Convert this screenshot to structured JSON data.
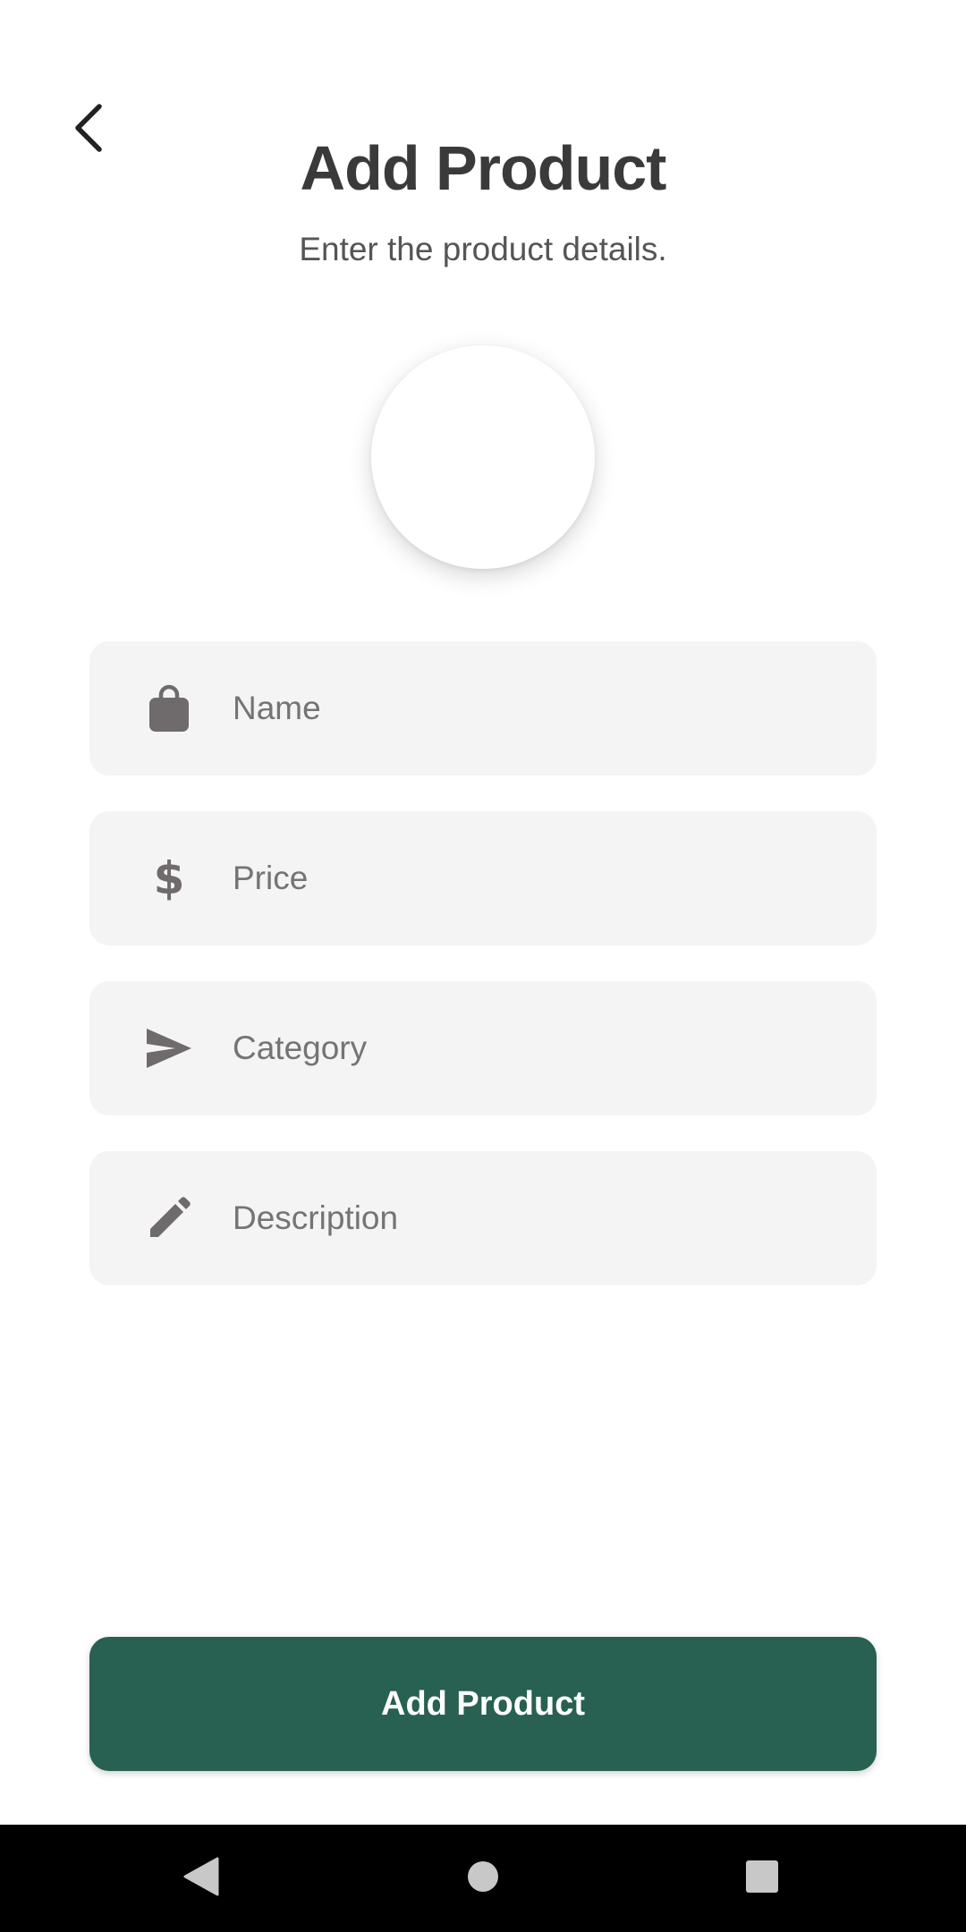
{
  "header": {
    "title": "Add Product",
    "subtitle": "Enter the product details.",
    "back_icon": "chevron-left-icon"
  },
  "image_picker": {
    "icon": "none"
  },
  "form": {
    "fields": [
      {
        "name": "name",
        "placeholder": "Name",
        "value": "",
        "icon": "shopping-bag-icon"
      },
      {
        "name": "price",
        "placeholder": "Price",
        "value": "",
        "icon": "dollar-icon",
        "glyph": "$"
      },
      {
        "name": "category",
        "placeholder": "Category",
        "value": "",
        "icon": "send-icon"
      },
      {
        "name": "description",
        "placeholder": "Description",
        "value": "",
        "icon": "pencil-icon"
      }
    ]
  },
  "submit": {
    "label": "Add Product"
  },
  "colors": {
    "primary": "#286051",
    "field_bg": "#f4f4f4",
    "icon": "#6f6a6c",
    "title": "#3a3a3a"
  },
  "system_nav": {
    "back_icon": "nav-back-icon",
    "home_icon": "nav-home-icon",
    "recents_icon": "nav-recents-icon"
  }
}
